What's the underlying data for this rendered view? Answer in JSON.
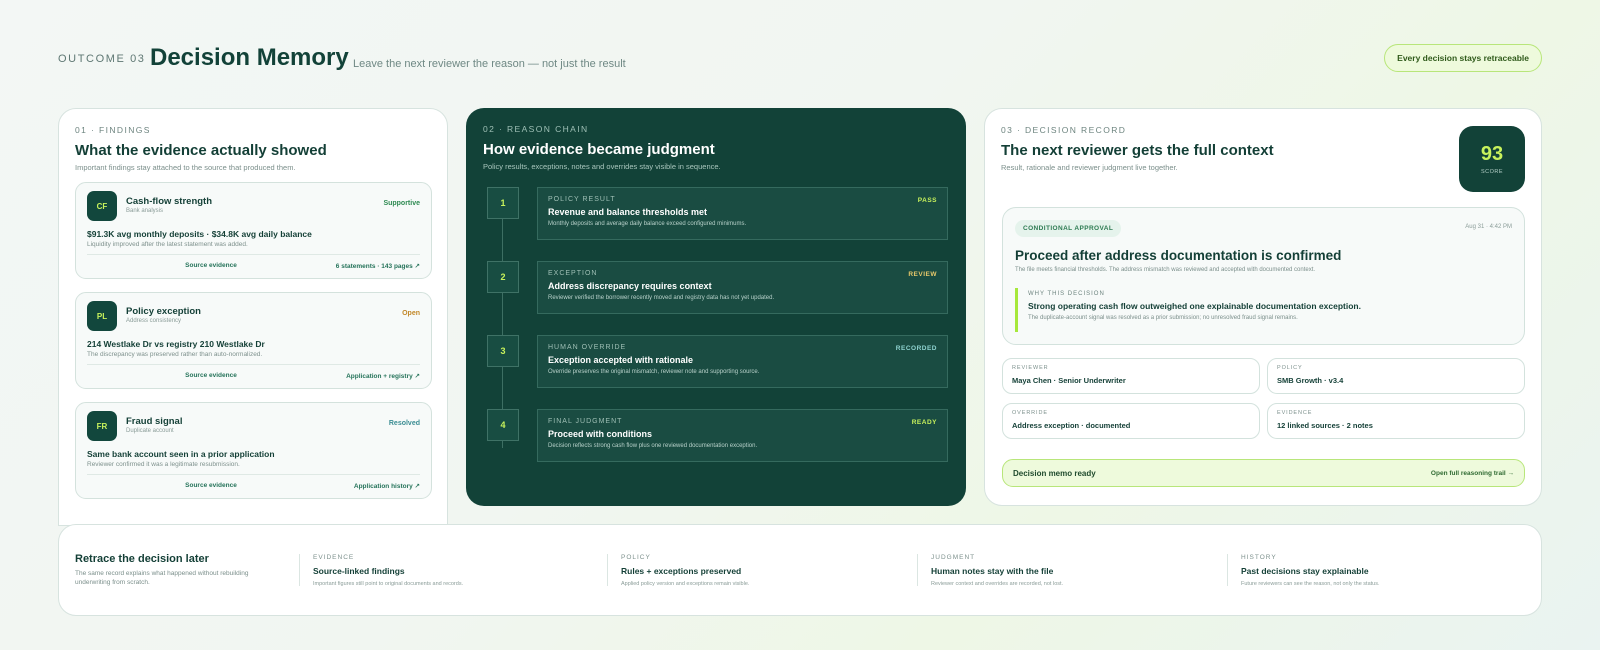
{
  "header": {
    "eyebrow": "OUTCOME 03",
    "title": "Decision Memory",
    "subtitle": "Leave the next reviewer the reason — not just the result",
    "badge": "Every decision stays retraceable"
  },
  "findings": {
    "eyebrow": "01 · FINDINGS",
    "title": "What the evidence actually showed",
    "subtitle": "Important findings stay attached to the source that produced them.",
    "items": [
      {
        "icon": "CF",
        "name": "Cash-flow strength",
        "meta": "Bank analysis",
        "status": "Supportive",
        "headline": "$91.3K avg monthly deposits · $34.8K avg daily balance",
        "note": "Liquidity improved after the latest statement was added.",
        "link_left": "Source evidence",
        "link_right": "6 statements · 143 pages ↗"
      },
      {
        "icon": "PL",
        "name": "Policy exception",
        "meta": "Address consistency",
        "status": "Open",
        "headline": "214 Westlake Dr vs registry 210 Westlake Dr",
        "note": "The discrepancy was preserved rather than auto-normalized.",
        "link_left": "Source evidence",
        "link_right": "Application + registry ↗"
      },
      {
        "icon": "FR",
        "name": "Fraud signal",
        "meta": "Duplicate account",
        "status": "Resolved",
        "headline": "Same bank account seen in a prior application",
        "note": "Reviewer confirmed it was a legitimate resubmission.",
        "link_left": "Source evidence",
        "link_right": "Application history ↗"
      }
    ]
  },
  "chain": {
    "eyebrow": "02 · REASON CHAIN",
    "title": "How evidence became judgment",
    "subtitle": "Policy results, exceptions, notes and overrides stay visible in sequence.",
    "steps": [
      {
        "num": "1",
        "kind": "POLICY RESULT",
        "badge": "PASS",
        "title": "Revenue and balance thresholds met",
        "desc": "Monthly deposits and average daily balance exceed configured minimums."
      },
      {
        "num": "2",
        "kind": "EXCEPTION",
        "badge": "REVIEW",
        "title": "Address discrepancy requires context",
        "desc": "Reviewer verified the borrower recently moved and registry data has not yet updated."
      },
      {
        "num": "3",
        "kind": "HUMAN OVERRIDE",
        "badge": "RECORDED",
        "title": "Exception accepted with rationale",
        "desc": "Override preserves the original mismatch, reviewer note and supporting source."
      },
      {
        "num": "4",
        "kind": "FINAL JUDGMENT",
        "badge": "READY",
        "title": "Proceed with conditions",
        "desc": "Decision reflects strong cash flow plus one reviewed documentation exception."
      }
    ]
  },
  "record": {
    "eyebrow": "03 · DECISION RECORD",
    "title": "The next reviewer gets the full context",
    "subtitle": "Result, rationale and reviewer judgment live together.",
    "score_value": "93",
    "score_label": "SCORE",
    "tag": "CONDITIONAL APPROVAL",
    "time": "Aug 31 · 4:42 PM",
    "decision_title": "Proceed after address documentation is confirmed",
    "decision_sub": "The file meets financial thresholds. The address mismatch was reviewed and accepted with documented context.",
    "why_label": "WHY THIS DECISION",
    "why_title": "Strong operating cash flow outweighed one explainable documentation exception.",
    "why_desc": "The duplicate-account signal was resolved as a prior submission; no unresolved fraud signal remains.",
    "meta": [
      {
        "label": "REVIEWER",
        "value": "Maya Chen · Senior Underwriter"
      },
      {
        "label": "POLICY",
        "value": "SMB Growth · v3.4"
      },
      {
        "label": "OVERRIDE",
        "value": "Address exception · documented"
      },
      {
        "label": "EVIDENCE",
        "value": "12 linked sources · 2 notes"
      }
    ],
    "memo_text": "Decision memo ready",
    "memo_link": "Open full reasoning trail →"
  },
  "strip": {
    "title": "Retrace the decision later",
    "desc": "The same record explains what happened without rebuilding underwriting from scratch.",
    "columns": [
      {
        "label": "EVIDENCE",
        "title": "Source-linked findings",
        "desc": "Important figures still point to original documents and records."
      },
      {
        "label": "POLICY",
        "title": "Rules + exceptions preserved",
        "desc": "Applied policy version and exceptions remain visible."
      },
      {
        "label": "JUDGMENT",
        "title": "Human notes stay with the file",
        "desc": "Reviewer context and overrides are recorded, not lost."
      },
      {
        "label": "HISTORY",
        "title": "Past decisions stay explainable",
        "desc": "Future reviewers can see the reason, not only the status."
      }
    ]
  },
  "colors": {
    "brand_dark": "#124238",
    "accent_lime": "#c8f25c",
    "supportive": "#2e8a52",
    "open": "#c2882a",
    "resolved": "#3b8d93"
  }
}
